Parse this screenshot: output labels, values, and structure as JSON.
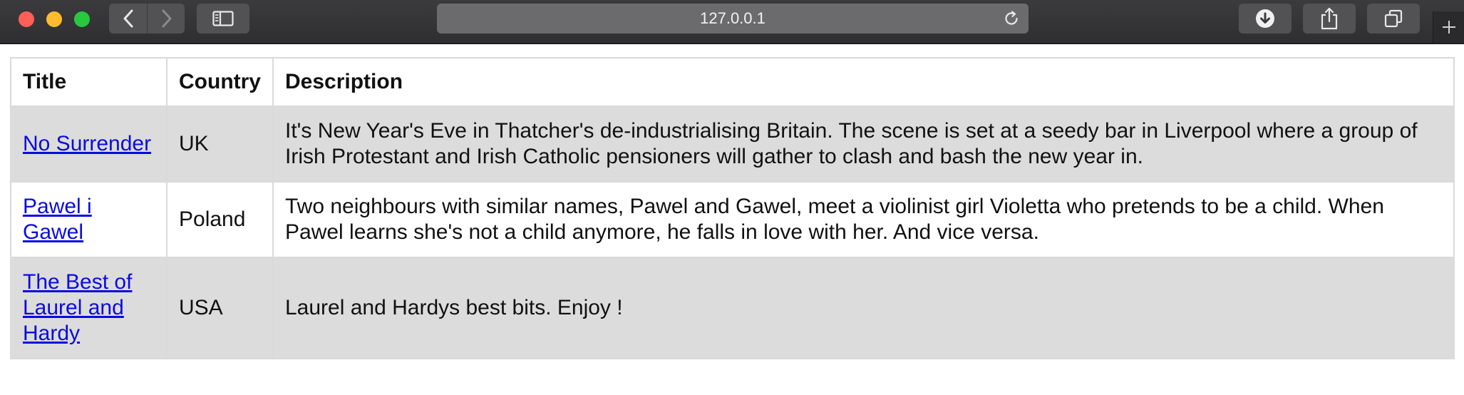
{
  "browser": {
    "url": "127.0.0.1",
    "icons": {
      "back": "chevron-left-icon",
      "forward": "chevron-right-icon",
      "sidebar": "sidebar-icon",
      "reload": "reload-icon",
      "download": "download-icon",
      "share": "share-icon",
      "tabs": "tabs-overview-icon",
      "new_tab": "plus-icon"
    },
    "colors": {
      "close": "#fe5f57",
      "minimize": "#febc2e",
      "maximize": "#28c840"
    }
  },
  "table": {
    "headers": {
      "title": "Title",
      "country": "Country",
      "description": "Description"
    },
    "rows": [
      {
        "title": "No Surrender",
        "country": "UK",
        "description": "It's New Year's Eve in Thatcher's de-industrialising Britain. The scene is set at a seedy bar in Liverpool where a group of Irish Protestant and Irish Catholic pensioners will gather to clash and bash the new year in."
      },
      {
        "title": "Pawel i Gawel",
        "country": "Poland",
        "description": "Two neighbours with similar names, Pawel and Gawel, meet a violinist girl Violetta who pretends to be a child. When Pawel learns she's not a child anymore, he falls in love with her. And vice versa."
      },
      {
        "title": "The Best of Laurel and Hardy",
        "country": "USA",
        "description": "Laurel and Hardys best bits. Enjoy !"
      }
    ],
    "colors": {
      "stripe": "#dcdcdc",
      "link": "#0b0be0",
      "border": "#dadada"
    }
  }
}
